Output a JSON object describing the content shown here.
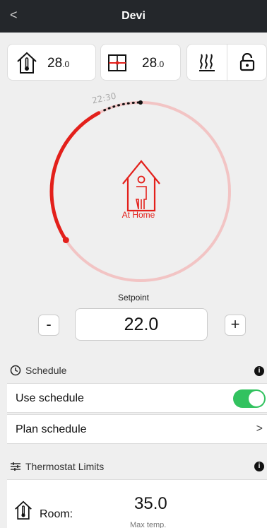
{
  "header": {
    "back_label": "<",
    "title": "Devi"
  },
  "status": {
    "room_temp": "28",
    "room_temp_decimal": ".0",
    "floor_temp": "28",
    "floor_temp_decimal": ".0"
  },
  "dial": {
    "time": "22:30",
    "mode": "At Home",
    "active_color": "#e3201b",
    "track_color": "#f2c4c4"
  },
  "setpoint": {
    "label": "Setpoint",
    "value": "22.0",
    "minus": "-",
    "plus": "+"
  },
  "schedule": {
    "title": "Schedule",
    "info": "i",
    "use_label": "Use schedule",
    "use_enabled": true,
    "plan_label": "Plan schedule",
    "plan_chevron": ">"
  },
  "limits": {
    "title": "Thermostat Limits",
    "info": "i",
    "room_label": "Room:",
    "room_value": "35.0",
    "room_sub": "Max temp."
  },
  "colors": {
    "toggle_on": "#32c25f",
    "header_bg": "#24272b"
  }
}
